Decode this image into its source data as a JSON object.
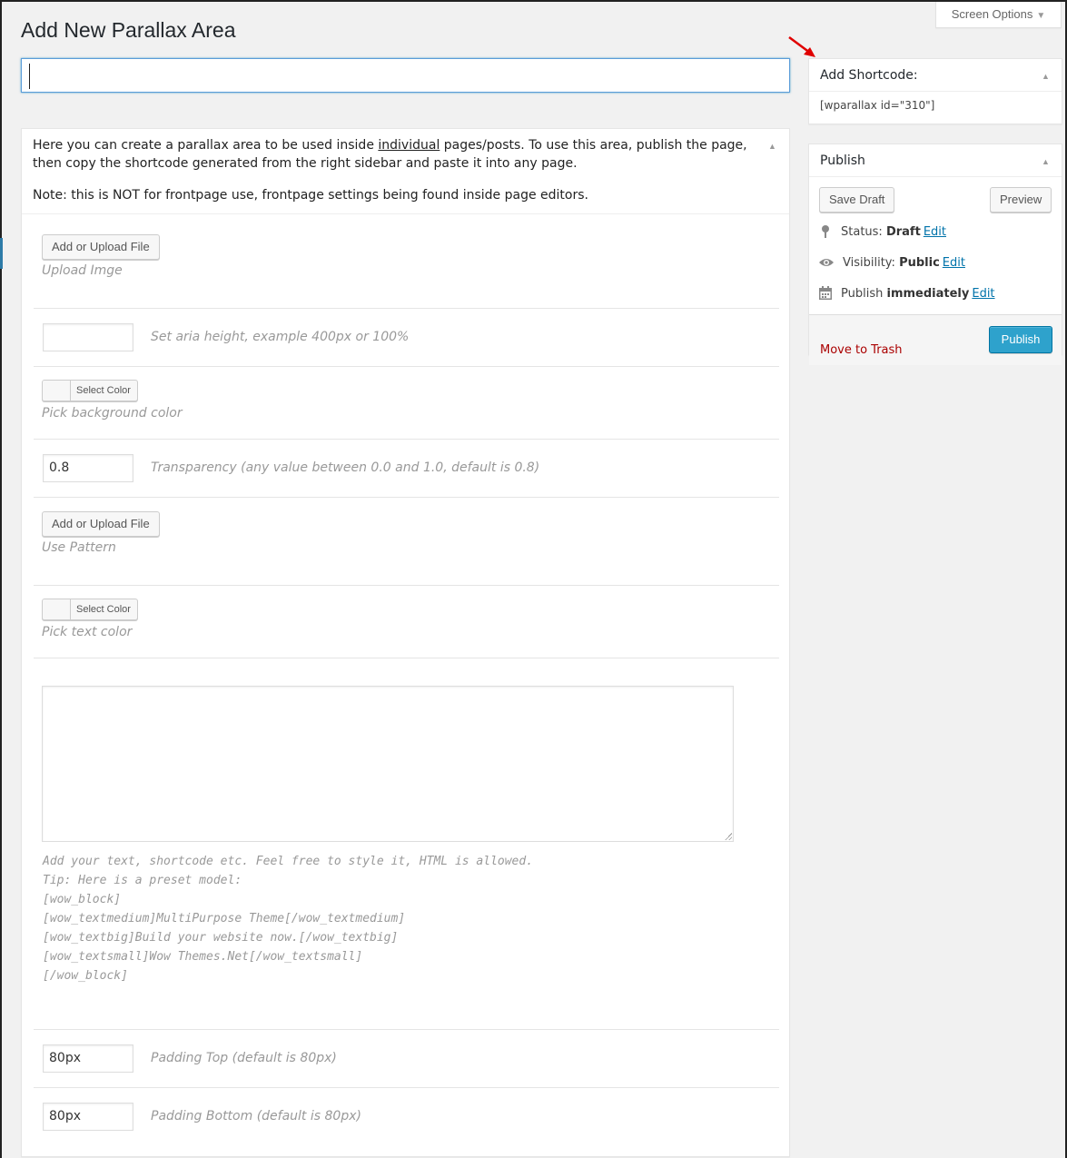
{
  "header": {
    "page_title": "Add New Parallax Area",
    "screen_options": "Screen Options"
  },
  "title_field": {
    "value": ""
  },
  "main": {
    "intro_before_link": "Here you can create a parallax area to be used inside ",
    "intro_link": "individual",
    "intro_after_link": " pages/posts. To use this area, publish the page, then copy the shortcode generated from the right sidebar and paste it into any page.",
    "intro_note": "Note: this is NOT for frontpage use, frontpage settings being found inside page editors.",
    "upload_image": {
      "button": "Add or Upload File",
      "desc": "Upload Imge"
    },
    "area_height": {
      "value": "",
      "desc": "Set aria height, example 400px or 100%"
    },
    "bg_color": {
      "button": "Select Color",
      "desc": "Pick background color"
    },
    "transparency": {
      "value": "0.8",
      "desc": "Transparency (any value between 0.0 and 1.0, default is 0.8)"
    },
    "pattern": {
      "button": "Add or Upload File",
      "desc": "Use Pattern"
    },
    "text_color": {
      "button": "Select Color",
      "desc": "Pick text color"
    },
    "content": {
      "value": "",
      "help_lines": [
        "Add your text, shortcode etc. Feel free to style it, HTML is allowed.",
        "Tip: Here is a preset model:",
        "[wow_block]",
        "[wow_textmedium]MultiPurpose Theme[/wow_textmedium]",
        "[wow_textbig]Build your website now.[/wow_textbig]",
        "[wow_textsmall]Wow Themes.Net[/wow_textsmall]",
        "[/wow_block]"
      ]
    },
    "padding_top": {
      "value": "80px",
      "desc": "Padding Top (default is 80px)"
    },
    "padding_bottom": {
      "value": "80px",
      "desc": "Padding Bottom (default is 80px)"
    }
  },
  "sidebar": {
    "shortcode_box": {
      "title": "Add Shortcode:",
      "shortcode": "[wparallax id=\"310\"]"
    },
    "publish_box": {
      "title": "Publish",
      "save_draft": "Save Draft",
      "preview": "Preview",
      "status_label": "Status:",
      "status_value": "Draft",
      "visibility_label": "Visibility:",
      "visibility_value": "Public",
      "publish_label": "Publish",
      "publish_value": "immediately",
      "edit": "Edit",
      "trash": "Move to Trash",
      "publish_button": "Publish"
    }
  },
  "colors": {
    "accent": "#2ea2cc",
    "link": "#0073aa",
    "trash": "#aa0000",
    "annotation_arrow": "#e00000"
  }
}
